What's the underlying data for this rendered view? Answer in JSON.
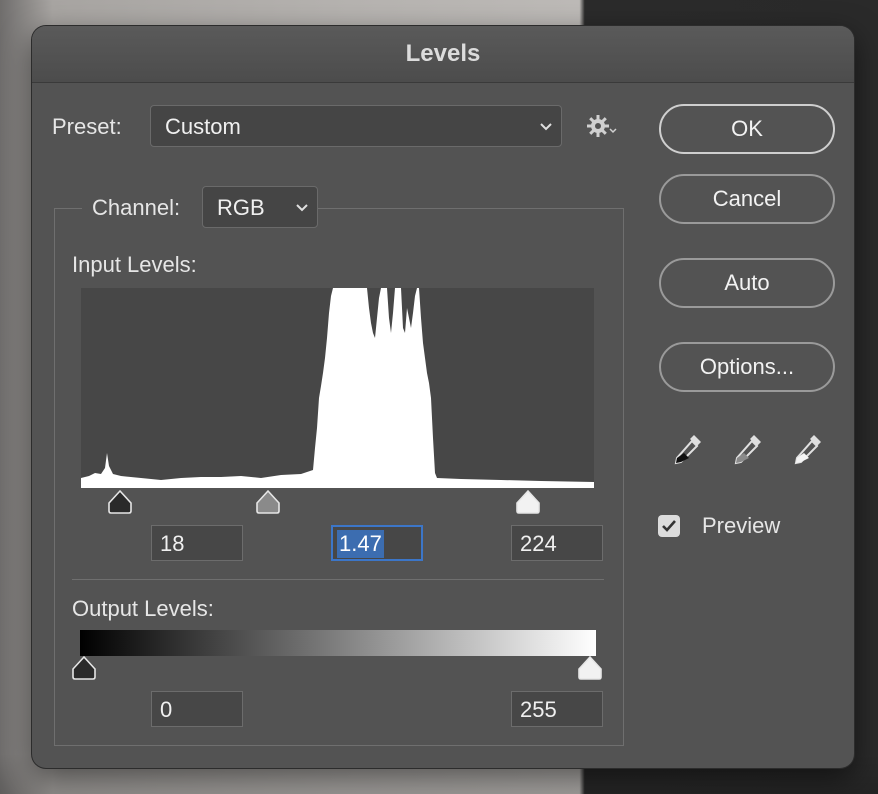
{
  "dialog": {
    "title": "Levels"
  },
  "preset": {
    "label": "Preset:",
    "value": "Custom",
    "menu_icon": "gear-icon"
  },
  "channel": {
    "label": "Channel:",
    "value": "RGB"
  },
  "input_levels": {
    "label": "Input Levels:",
    "black": "18",
    "gamma": "1.47",
    "white": "224"
  },
  "output_levels": {
    "label": "Output Levels:",
    "black": "0",
    "white": "255"
  },
  "buttons": {
    "ok": "OK",
    "cancel": "Cancel",
    "auto": "Auto",
    "options": "Options..."
  },
  "eyedroppers": [
    "black-eyedropper-icon",
    "gray-eyedropper-icon",
    "white-eyedropper-icon"
  ],
  "preview": {
    "label": "Preview",
    "checked": true
  },
  "colors": {
    "dialog_bg": "#535353",
    "histogram_bg": "#474747",
    "focus_accent": "#3c76c8"
  }
}
